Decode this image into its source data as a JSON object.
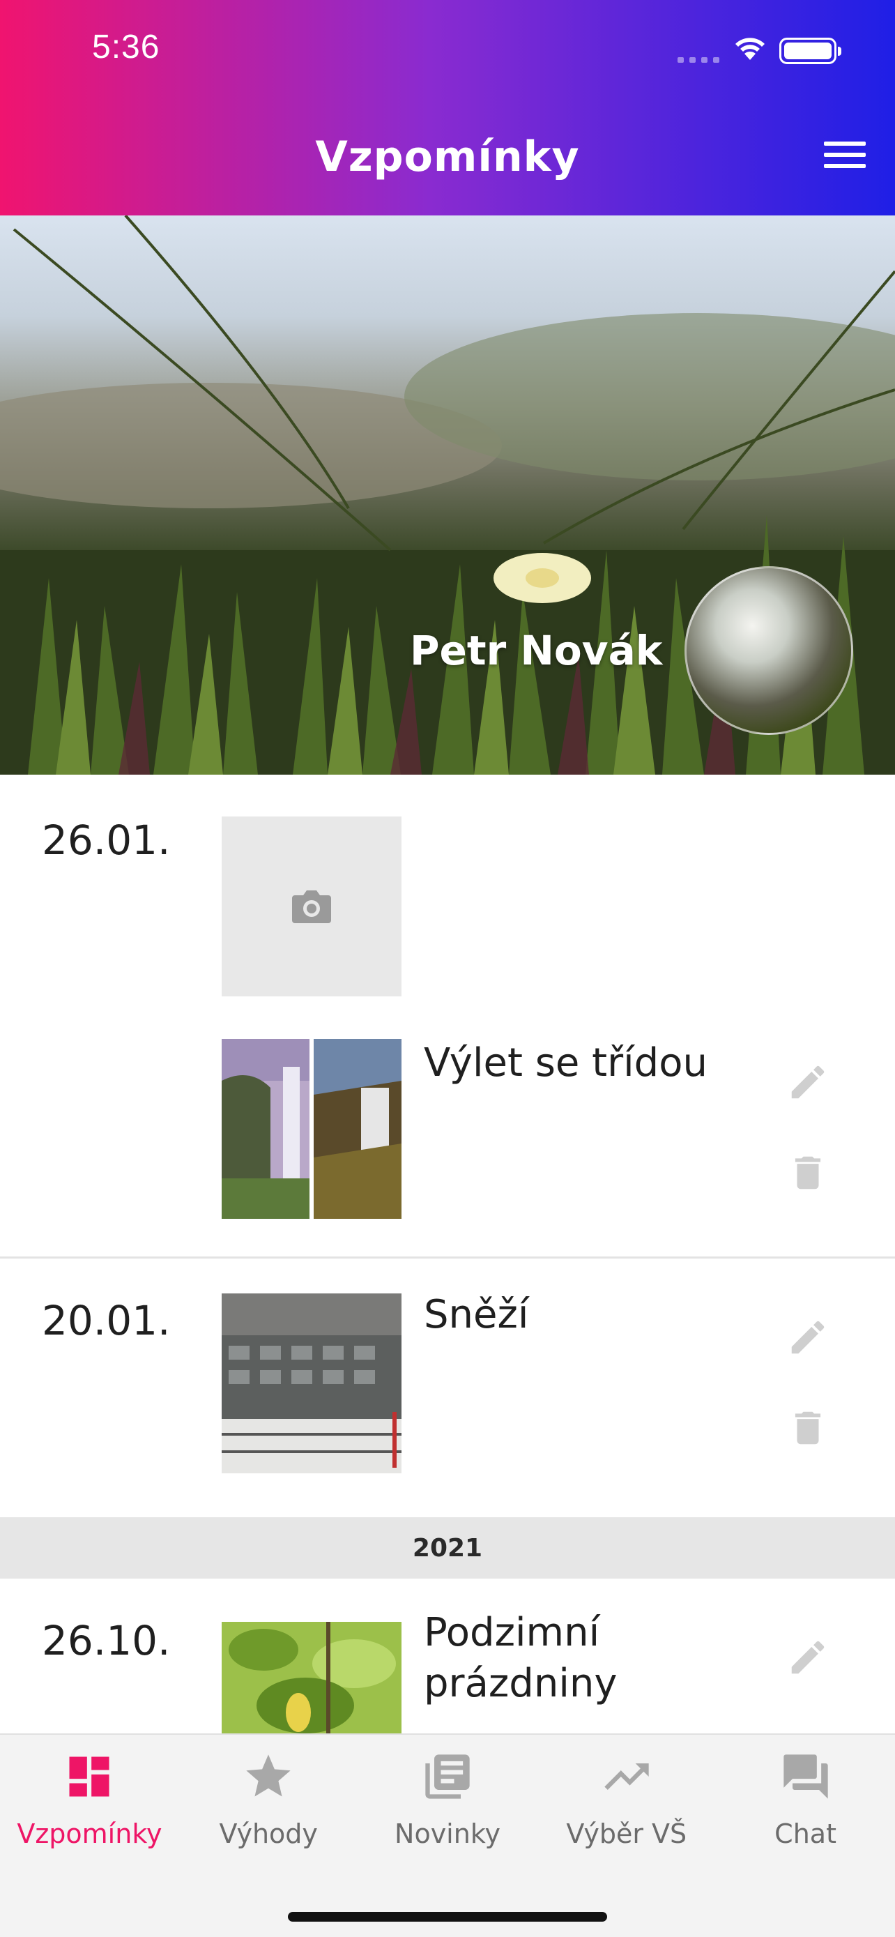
{
  "status_bar": {
    "time": "5:36"
  },
  "header": {
    "title": "Vzpomínky"
  },
  "profile": {
    "name": "Petr Novák"
  },
  "entries": [
    {
      "date": "26.01.",
      "title": ""
    },
    {
      "date": "",
      "title": "Výlet se třídou"
    },
    {
      "date": "20.01.",
      "title": "Sněží"
    },
    {
      "date": "26.10.",
      "title": "Podzimní prázdniny"
    }
  ],
  "year_separator": "2021",
  "tabs": [
    {
      "label": "Vzpomínky",
      "icon": "dashboard-icon",
      "active": true
    },
    {
      "label": "Výhody",
      "icon": "star-icon",
      "active": false
    },
    {
      "label": "Novinky",
      "icon": "news-icon",
      "active": false
    },
    {
      "label": "Výběr VŠ",
      "icon": "trending-up-icon",
      "active": false
    },
    {
      "label": "Chat",
      "icon": "chat-icon",
      "active": false
    }
  ],
  "colors": {
    "accent": "#ee1566",
    "header_start": "#f0146f",
    "header_end": "#1f1fe6",
    "inactive": "#9a9a9a"
  }
}
